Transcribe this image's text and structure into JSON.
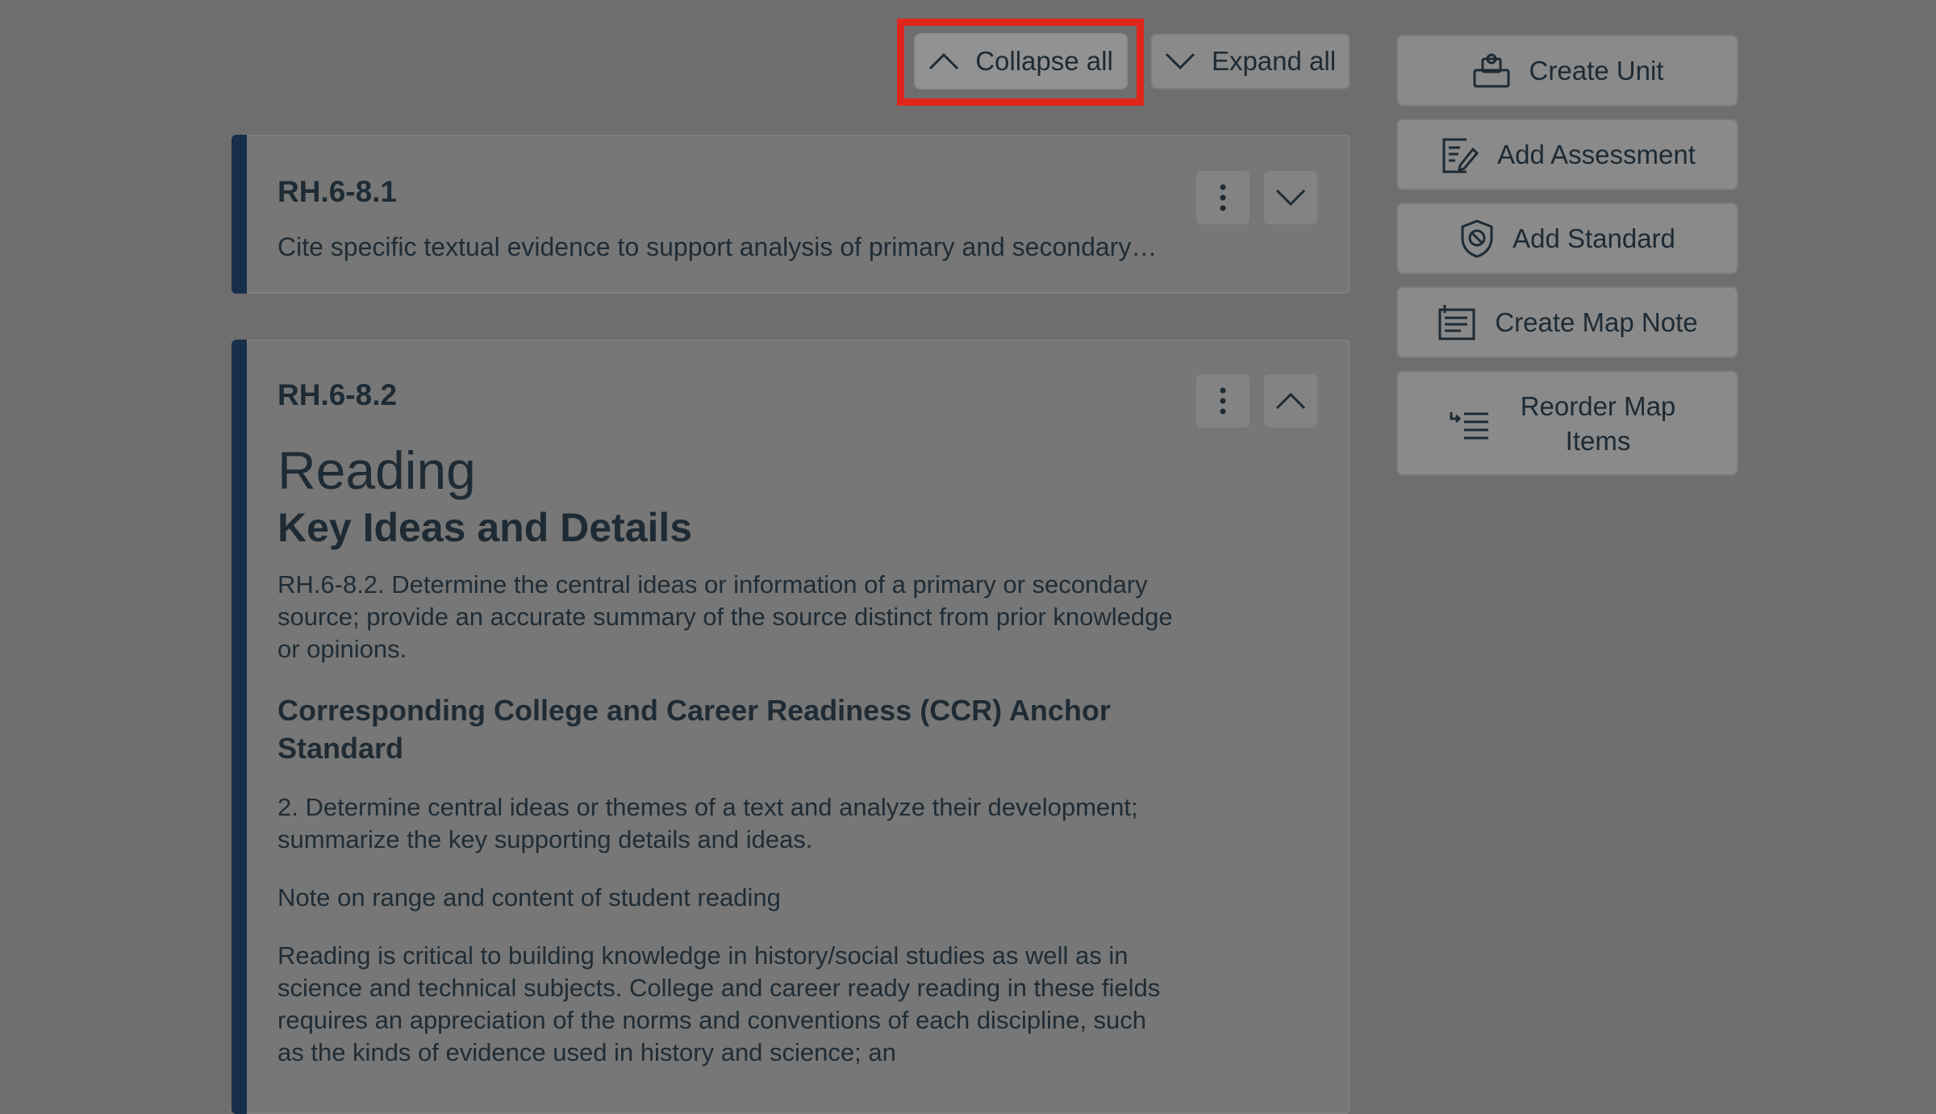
{
  "toolbar": {
    "collapse_all_label": "Collapse all",
    "expand_all_label": "Expand all"
  },
  "sidebar": {
    "create_unit": "Create Unit",
    "add_assessment": "Add Assessment",
    "add_standard": "Add Standard",
    "create_map_note": "Create Map Note",
    "reorder_line1": "Reorder Map",
    "reorder_line2": "Items"
  },
  "cards": [
    {
      "code": "RH.6-8.1",
      "summary": "Cite specific textual evidence to support analysis of primary and secondary…",
      "state": "collapsed"
    },
    {
      "code": "RH.6-8.2",
      "state": "expanded",
      "heading": "Reading",
      "subheading": "Key Ideas and Details",
      "standard_text": "RH.6-8.2. Determine the central ideas or information of a primary or secondary source; provide an accurate summary of the source distinct from prior knowledge or opinions.",
      "ccr_heading": "Corresponding College and Career Readiness (CCR) Anchor Standard",
      "ccr_text": "2. Determine central ideas or themes of a text and analyze their development; summarize the key supporting details and ideas.",
      "note_heading": "Note on range and content of student reading",
      "note_text": "Reading is critical to building knowledge in history/social studies as well as in science and technical subjects. College and career ready reading in these fields requires an appreciation of the norms and conventions of each discipline, such as the kinds of evidence used in history and science; an"
    }
  ],
  "icons": [
    "chevron-up-icon",
    "chevron-down-icon",
    "unit-icon",
    "assessment-icon",
    "standard-icon",
    "map-note-icon",
    "reorder-icon",
    "kebab-menu-icon"
  ],
  "colors": {
    "highlight": "#e0261b",
    "card_accent": "#182f4c"
  }
}
